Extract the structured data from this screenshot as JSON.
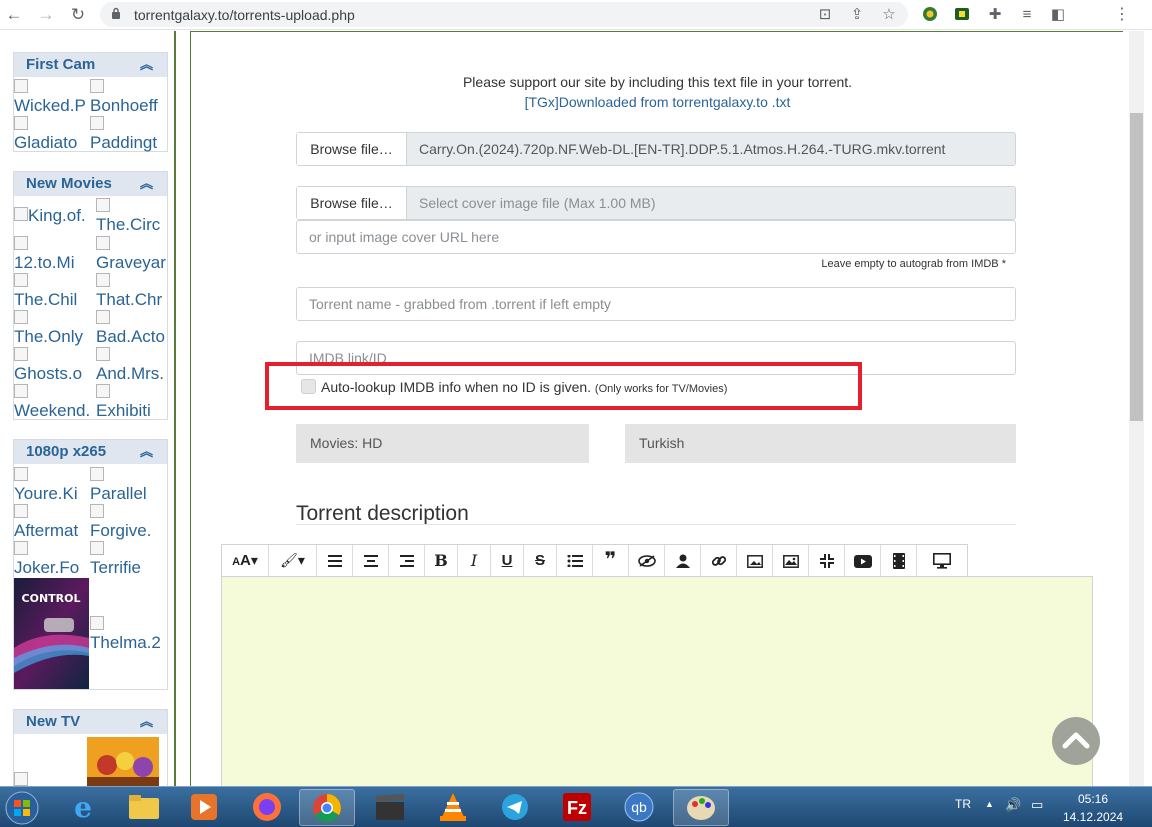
{
  "browser": {
    "url": "torrentgalaxy.to/torrents-upload.php"
  },
  "sidebar": {
    "sections": [
      {
        "title": "First Cam",
        "items": [
          "Wicked.P",
          "Bonhoeff",
          "Gladiato",
          "Paddingt"
        ]
      },
      {
        "title": "New Movies",
        "items": [
          "King.of.",
          "The.Circ",
          "12.to.Mi",
          "Graveyar",
          "The.Chil",
          "That.Chr",
          "The.Only",
          "Bad.Acto",
          "Ghosts.o",
          "And.Mrs.",
          "Weekend.",
          "Exhibiti"
        ]
      },
      {
        "title": "1080p x265",
        "items": [
          "Youre.Ki",
          "Parallel",
          "Aftermat",
          "Forgive.",
          "Joker.Fo",
          "Terrifie",
          "Thelma.2"
        ],
        "poster_text": "CONTROL"
      },
      {
        "title": "New TV",
        "items": []
      }
    ]
  },
  "upload": {
    "support_text": "Please support our site by including this text file in your torrent.",
    "support_link": "[TGx]Downloaded from torrentgalaxy.to .txt",
    "browse_label": "Browse file…",
    "torrent_file": "Carry.On.(2024).720p.NF.Web-DL.[EN-TR].DDP.5.1.Atmos.H.264.-TURG.mkv.torrent",
    "cover_placeholder": "Select cover image file (Max 1.00 MB)",
    "cover_url_placeholder": "or input image cover URL here",
    "cover_hint": "Leave empty to autograb from IMDB *",
    "name_placeholder": "Torrent name - grabbed from .torrent if left empty",
    "imdb_placeholder": "IMDB link/ID",
    "auto_lookup_label": "Auto-lookup IMDB info when no ID is given.",
    "auto_lookup_note": "(Only works for TV/Movies)",
    "category": "Movies: HD",
    "language": "Turkish",
    "description_title": "Torrent description"
  },
  "toolbar": {
    "buttons": [
      "font-size",
      "color",
      "align-left",
      "align-center",
      "align-right",
      "bold",
      "italic",
      "underline",
      "strikethrough",
      "list",
      "quote",
      "spoiler",
      "user",
      "link",
      "image",
      "image-gallery",
      "compress",
      "youtube",
      "video-file",
      "screen"
    ]
  },
  "taskbar": {
    "language": "TR",
    "time": "05:16",
    "date": "14.12.2024"
  },
  "colors": {
    "highlight": "#e3202d",
    "link": "#2a6496",
    "editor_bg": "#f5fbd8"
  }
}
